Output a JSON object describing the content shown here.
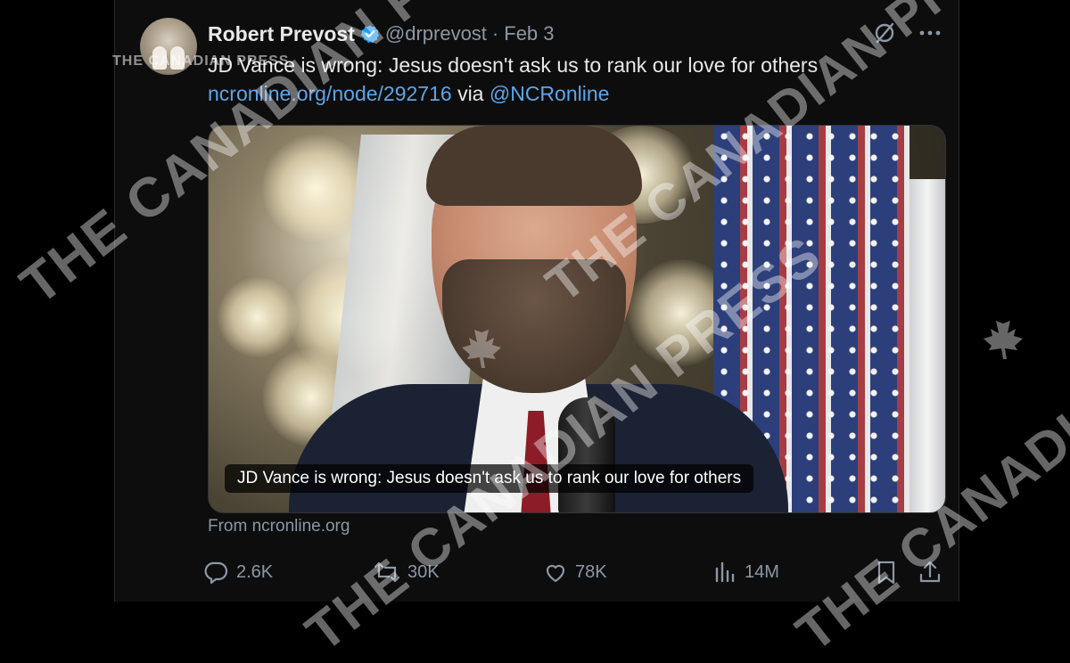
{
  "author": {
    "name": "Robert Prevost",
    "handle": "@drprevost",
    "separator": "·",
    "date": "Feb 3",
    "verified": true,
    "avatar_icon": "avatar-photo"
  },
  "tweet": {
    "text": "JD Vance is wrong: Jesus doesn't ask us to rank our love for others",
    "link": "ncronline.org/node/292716",
    "via_word": "via",
    "mention": "@NCRonline"
  },
  "media": {
    "caption": "JD Vance is wrong: Jesus doesn't ask us to rank our love for others",
    "source": "From ncronline.org"
  },
  "actions": {
    "replies": "2.6K",
    "reposts": "30K",
    "likes": "78K",
    "views": "14M"
  },
  "watermark": {
    "main": "THE CANADIAN PRESS",
    "small": "THE CANADIAN PRESS"
  },
  "colors": {
    "link": "#5ea5ea",
    "verified_badge": "#1d9bf0",
    "muted": "#8b98a5",
    "text": "#e7e9ea",
    "background": "#0d0d0d"
  },
  "icons": [
    "grok-slash-icon",
    "more-icon",
    "reply-icon",
    "repost-icon",
    "like-icon",
    "views-icon",
    "bookmark-icon",
    "share-icon"
  ]
}
